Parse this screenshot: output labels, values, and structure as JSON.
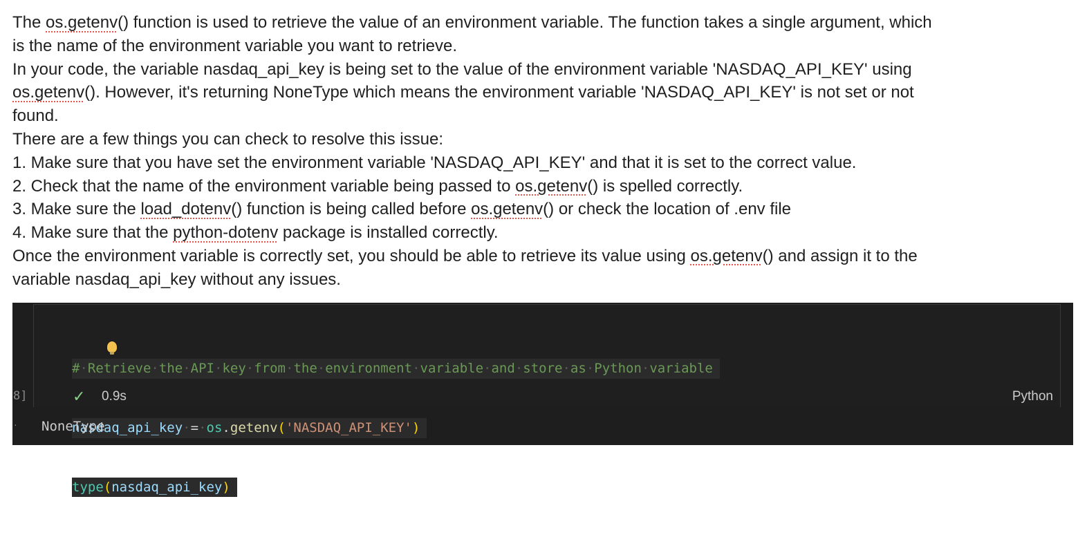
{
  "answer": {
    "p1a": "The ",
    "p1_code": "os.getenv",
    "p1b": "() function is used to retrieve the value of an environment variable. The function takes a single argument, which",
    "p2": "is the name of the environment variable you want to retrieve.",
    "p3": "In your code, the variable nasdaq_api_key is being set to the value of the environment variable 'NASDAQ_API_KEY' using",
    "p4_code": "os.getenv",
    "p4b": "(). However, it's returning NoneType which means the environment variable 'NASDAQ_API_KEY' is not set or not",
    "p5": "found.",
    "p6": "There are a few things you can check to resolve this issue:",
    "step1": "1. Make sure that you have set the environment variable 'NASDAQ_API_KEY' and that it is set to the correct value.",
    "step2a": "2. Check that the name of the environment variable being passed to ",
    "step2_code": "os.getenv",
    "step2b": "() is spelled correctly.",
    "step3a": "3. Make sure the ",
    "step3_code1": "load_dotenv",
    "step3b": "() function is being called before ",
    "step3_code2": "os.getenv",
    "step3c": "() or check the location of .env file",
    "step4a": "4. Make sure that the ",
    "step4_code": "python-dotenv",
    "step4b": " package is installed correctly.",
    "p7a": "Once the environment variable is correctly set, you should be able to retrieve its value using ",
    "p7_code": "os.getenv",
    "p7b": "() and assign it to the",
    "p8": "variable nasdaq_api_key without any issues."
  },
  "cell": {
    "code_line1": "# Retrieve the API key from the environment variable and store as Python variable",
    "code_line2": {
      "var_head": "n",
      "var_tail": "asdaq_api_key",
      "eq": "=",
      "module": "os",
      "dot": ".",
      "func": "getenv",
      "open": "(",
      "arg": "'NASDAQ_API_KEY'",
      "close": ")"
    },
    "code_line3": {
      "func": "type",
      "open": "(",
      "arg": "nasdaq_api_key",
      "close": ")"
    },
    "exec_count": "8]",
    "status_icon": "check-icon",
    "duration": "0.9s",
    "language": "Python",
    "output_marker": "·",
    "output": "NoneType"
  },
  "colors": {
    "editor_bg": "#1e1e1e",
    "comment": "#6a9955",
    "string": "#ce9178",
    "variable": "#9cdcfe",
    "success": "#89d185",
    "spellcheck": "#e5534b"
  }
}
